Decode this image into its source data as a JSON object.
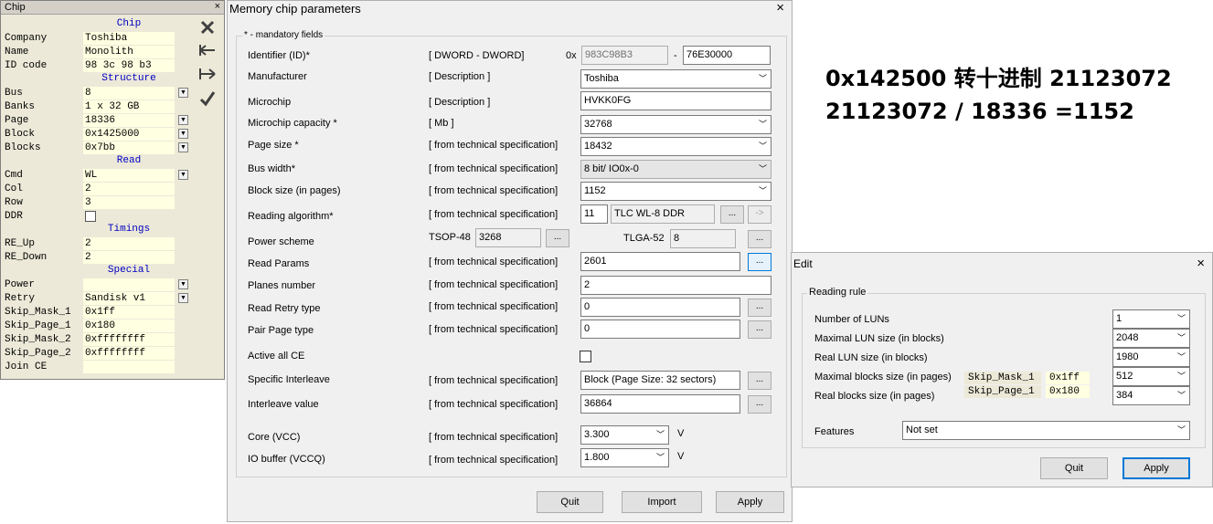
{
  "chip": {
    "window_title": "Chip",
    "close_glyph": "×",
    "sections": {
      "chip": "Chip",
      "structure": "Structure",
      "read": "Read",
      "timings": "Timings",
      "special": "Special"
    },
    "rows": {
      "company": {
        "label": "Company",
        "value": "Toshiba"
      },
      "name": {
        "label": "Name",
        "value": "Monolith"
      },
      "id_code": {
        "label": "ID code",
        "value": "98 3c 98 b3"
      },
      "bus": {
        "label": "Bus",
        "value": "8"
      },
      "banks": {
        "label": "Banks",
        "value": "1 x 32 GB"
      },
      "page": {
        "label": "Page",
        "value": "18336"
      },
      "block": {
        "label": "Block",
        "value": "0x1425000"
      },
      "blocks": {
        "label": "Blocks",
        "value": "0x7bb"
      },
      "cmd": {
        "label": "Cmd",
        "value": "WL"
      },
      "col": {
        "label": "Col",
        "value": "2"
      },
      "row": {
        "label": "Row",
        "value": "3"
      },
      "ddr": {
        "label": "DDR"
      },
      "re_up": {
        "label": "RE_Up",
        "value": "2"
      },
      "re_down": {
        "label": "RE_Down",
        "value": "2"
      },
      "power": {
        "label": "Power",
        "value": ""
      },
      "retry": {
        "label": "Retry",
        "value": "Sandisk v1"
      },
      "skip_mask_1": {
        "label": "Skip_Mask_1",
        "value": "0x1ff"
      },
      "skip_page_1": {
        "label": "Skip_Page_1",
        "value": "0x180"
      },
      "skip_mask_2": {
        "label": "Skip_Mask_2",
        "value": "0xffffffff"
      },
      "skip_page_2": {
        "label": "Skip_Page_2",
        "value": "0xffffffff"
      },
      "join_ce": {
        "label": "Join CE",
        "value": ""
      }
    },
    "side_icons": [
      "close-x-icon",
      "arrow-left-icon",
      "arrow-right-icon",
      "checkmark-icon"
    ]
  },
  "mem": {
    "title": "Memory chip parameters",
    "close_glyph": "×",
    "mandatory": "* - mandatory fields",
    "id_prefix": "0x",
    "id_dash": "-",
    "fields": {
      "identifier": {
        "label": "Identifier (ID)*",
        "desc": "[ DWORD - DWORD]",
        "value1": "983C98B3",
        "value2": "76E30000"
      },
      "manufacturer": {
        "label": "Manufacturer",
        "desc": "[ Description ]",
        "value": "Toshiba"
      },
      "microchip": {
        "label": "Microchip",
        "desc": "[ Description ]",
        "value": "HVKK0FG"
      },
      "capacity": {
        "label": "Microchip capacity *",
        "desc": "[ Mb ]",
        "value": "32768"
      },
      "page_size": {
        "label": "Page size *",
        "desc": "[ from technical specification]",
        "value": "18432"
      },
      "bus_width": {
        "label": "Bus width*",
        "desc": "[ from technical specification]",
        "value": "8 bit/ IO0x-0"
      },
      "block_size": {
        "label": "Block size (in pages)",
        "desc": "[ from technical specification]",
        "value": "1152"
      },
      "reading_algorithm": {
        "label": "Reading algorithm*",
        "desc": "[ from technical specification]",
        "num": "11",
        "name": "TLC WL-8 DDR",
        "btn": "...",
        "btn2": "->"
      },
      "power_scheme": {
        "label": "Power scheme",
        "tsop_label": "TSOP-48",
        "tsop_value": "3268",
        "tlga_label": "TLGA-52",
        "tlga_value": "8",
        "btn": "..."
      },
      "read_params": {
        "label": "Read Params",
        "desc": "[ from technical specification]",
        "value": "2601",
        "btn": "..."
      },
      "planes_number": {
        "label": "Planes number",
        "desc": "[ from technical specification]",
        "value": "2"
      },
      "read_retry_type": {
        "label": "Read Retry type",
        "desc": "[ from technical specification]",
        "value": "0",
        "btn": "..."
      },
      "pair_page_type": {
        "label": "Pair Page type",
        "desc": "[ from technical specification]",
        "value": "0",
        "btn": "..."
      },
      "active_all_ce": {
        "label": "Active all CE"
      },
      "specific_interleave": {
        "label": "Specific Interleave",
        "desc": "[ from technical specification]",
        "value": "Block (Page Size: 32 sectors)",
        "btn": "..."
      },
      "interleave_value": {
        "label": "Interleave value",
        "desc": "[ from technical specification]",
        "value": "36864",
        "btn": "..."
      },
      "core_vcc": {
        "label": "Core (VCC)",
        "desc": "[ from technical specification]",
        "value": "3.300",
        "unit": "V"
      },
      "io_buffer": {
        "label": "IO buffer (VCCQ)",
        "desc": "[ from technical specification]",
        "value": "1.800",
        "unit": "V"
      }
    },
    "buttons": {
      "quit": "Quit",
      "import": "Import",
      "apply": "Apply"
    }
  },
  "notes": {
    "line1": "0x142500 转十进制 21123072",
    "line2": "21123072 / 18336 =1152"
  },
  "edit": {
    "title": "Edit",
    "close_glyph": "×",
    "group": "Reading rule",
    "fields": {
      "number_of_luns": {
        "label": "Number of LUNs",
        "value": "1"
      },
      "max_lun_size": {
        "label": "Maximal LUN size (in blocks)",
        "value": "2048"
      },
      "real_lun_size": {
        "label": "Real LUN size (in blocks)",
        "value": "1980"
      },
      "max_blocks_size": {
        "label": "Maximal blocks size (in pages)",
        "value": "512"
      },
      "real_blocks_size": {
        "label": "Real blocks size (in pages)",
        "value": "384"
      },
      "features": {
        "label": "Features",
        "value": "Not set"
      }
    },
    "overlay": {
      "mask_label": "Skip_Mask_1",
      "mask_value": "0x1ff",
      "page_label": "Skip_Page_1",
      "page_value": "0x180"
    },
    "buttons": {
      "quit": "Quit",
      "apply": "Apply"
    }
  }
}
